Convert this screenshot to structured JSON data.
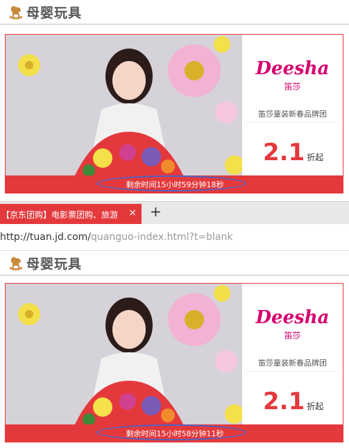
{
  "section_title": "母婴玩具",
  "top_card": {
    "brand_logo": "Deesha",
    "brand_cn": "笛莎",
    "brand_desc": "笛莎童装新春品牌团",
    "discount_value": "2.1",
    "discount_unit": "折起",
    "countdown": "剩余时间15小时59分钟18秒"
  },
  "browser": {
    "tab_title": "【京东团购】电影票团购、旅游",
    "tab_close": "×",
    "new_tab": "+",
    "url_host": "http://tuan.jd.com/",
    "url_path": "quanguo-index.html?t=blank"
  },
  "bottom_card": {
    "brand_logo": "Deesha",
    "brand_cn": "笛莎",
    "brand_desc": "笛莎童装新春品牌团",
    "discount_value": "2.1",
    "discount_unit": "折起",
    "countdown": "剩余时间15小时58分钟11秒"
  },
  "colors": {
    "accent": "#e4393c",
    "brand": "#d6006f",
    "highlight_ellipse": "#4a63c8"
  }
}
